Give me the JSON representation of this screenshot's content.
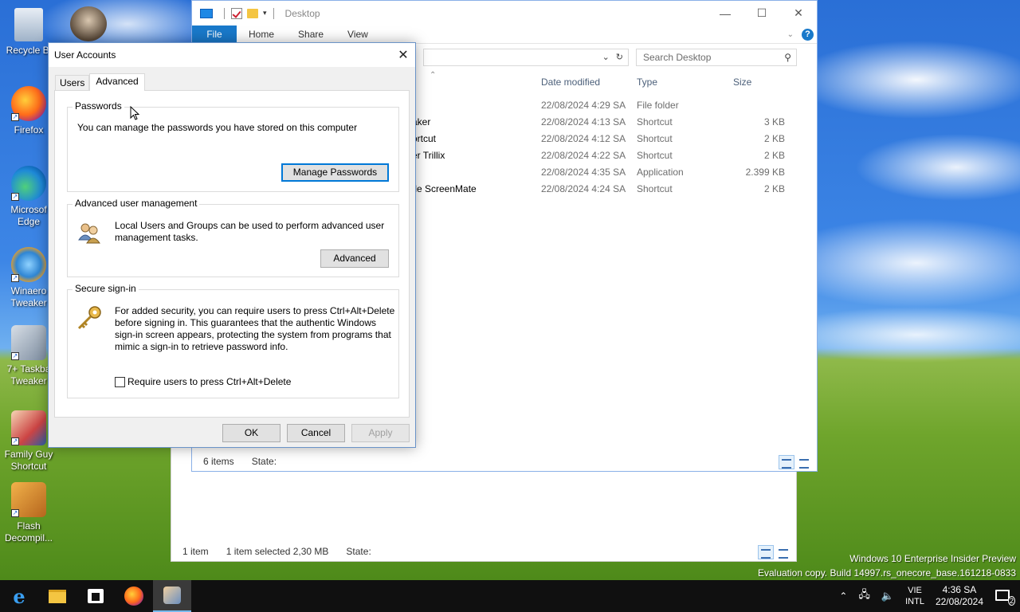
{
  "desktop": {
    "icons": [
      {
        "label": "Recycle Bi"
      },
      {
        "label": "Firefox"
      },
      {
        "label": "Microsof Edge"
      },
      {
        "label": "Winaero Tweaker"
      },
      {
        "label": "7+ Taskba Tweaker"
      },
      {
        "label": "Family Guy Shortcut"
      },
      {
        "label": "Flash Decompil..."
      }
    ]
  },
  "explorer": {
    "title": "Desktop",
    "ribbon_tabs": [
      "File",
      "Home",
      "Share",
      "View"
    ],
    "search_placeholder": "Search Desktop",
    "columns": {
      "date": "Date modified",
      "type": "Type",
      "size": "Size"
    },
    "rows": [
      {
        "name": "",
        "date": "22/08/2024 4:29 SA",
        "type": "File folder",
        "size": ""
      },
      {
        "name": "aker",
        "date": "22/08/2024 4:13 SA",
        "type": "Shortcut",
        "size": "3 KB"
      },
      {
        "name": "ortcut",
        "date": "22/08/2024 4:12 SA",
        "type": "Shortcut",
        "size": "2 KB"
      },
      {
        "name": "er Trillix",
        "date": "22/08/2024 4:22 SA",
        "type": "Shortcut",
        "size": "2 KB"
      },
      {
        "name": "",
        "date": "22/08/2024 4:35 SA",
        "type": "Application",
        "size": "2.399 KB"
      },
      {
        "name": "tle ScreenMate",
        "date": "22/08/2024 4:24 SA",
        "type": "Shortcut",
        "size": "2 KB"
      }
    ],
    "status": {
      "items": "6 items",
      "state": "State:"
    }
  },
  "explorer_back": {
    "status": {
      "items": "1 item",
      "selected": "1 item selected  2,30 MB",
      "state": "State:"
    }
  },
  "dialog": {
    "title": "User Accounts",
    "tabs": {
      "users": "Users",
      "advanced": "Advanced"
    },
    "passwords": {
      "legend": "Passwords",
      "text": "You can manage the passwords you have stored on this computer",
      "button": "Manage Passwords"
    },
    "advanced_user": {
      "legend": "Advanced user management",
      "text": "Local Users and Groups can be used to perform advanced user management tasks.",
      "button": "Advanced"
    },
    "secure": {
      "legend": "Secure sign-in",
      "text": "For added security, you can require users to press Ctrl+Alt+Delete before signing in. This guarantees that the authentic Windows sign-in screen appears, protecting the system from programs that mimic a sign-in to retrieve password info.",
      "checkbox_label": "Require users to press Ctrl+Alt+Delete",
      "checked": false
    },
    "buttons": {
      "ok": "OK",
      "cancel": "Cancel",
      "apply": "Apply"
    }
  },
  "watermark": {
    "line1": "Windows 10 Enterprise Insider Preview",
    "line2": "Evaluation copy. Build 14997.rs_onecore_base.161218-0833"
  },
  "taskbar": {
    "lang_day": "VIE",
    "lang": "INTL",
    "time": "4:36 SA",
    "date": "22/08/2024",
    "notification_count": "2"
  },
  "colors": {
    "accent": "#0078d7",
    "file_tab": "#1979ca",
    "taskbar": "#101010"
  }
}
